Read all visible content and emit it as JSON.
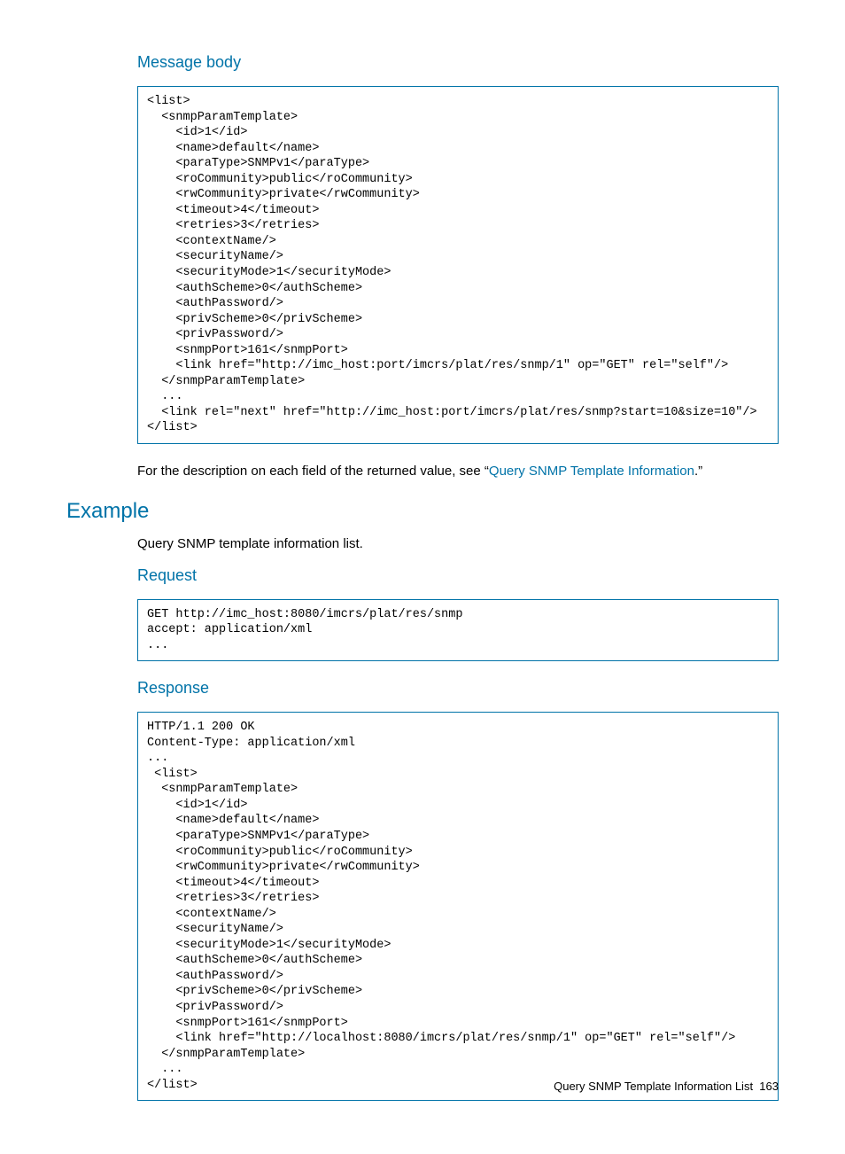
{
  "section_message_body": {
    "heading": "Message body",
    "code": "<list>\n  <snmpParamTemplate>\n    <id>1</id>\n    <name>default</name>\n    <paraType>SNMPv1</paraType>\n    <roCommunity>public</roCommunity>\n    <rwCommunity>private</rwCommunity>\n    <timeout>4</timeout>\n    <retries>3</retries>\n    <contextName/>\n    <securityName/>\n    <securityMode>1</securityMode>\n    <authScheme>0</authScheme>\n    <authPassword/>\n    <privScheme>0</privScheme>\n    <privPassword/>\n    <snmpPort>161</snmpPort>\n    <link href=\"http://imc_host:port/imcrs/plat/res/snmp/1\" op=\"GET\" rel=\"self\"/>\n  </snmpParamTemplate>\n  ...\n  <link rel=\"next\" href=\"http://imc_host:port/imcrs/plat/res/snmp?start=10&size=10\"/>\n</list>"
  },
  "description_para": {
    "prefix": "For the description on each field of the returned value, see “",
    "link_text": "Query SNMP Template Information",
    "suffix": ".”"
  },
  "example": {
    "heading": "Example",
    "intro": "Query SNMP template information list."
  },
  "request": {
    "heading": "Request",
    "code": "GET http://imc_host:8080/imcrs/plat/res/snmp\naccept: application/xml\n..."
  },
  "response": {
    "heading": "Response",
    "code": "HTTP/1.1 200 OK\nContent-Type: application/xml\n...\n <list>\n  <snmpParamTemplate>\n    <id>1</id>\n    <name>default</name>\n    <paraType>SNMPv1</paraType>\n    <roCommunity>public</roCommunity>\n    <rwCommunity>private</rwCommunity>\n    <timeout>4</timeout>\n    <retries>3</retries>\n    <contextName/>\n    <securityName/>\n    <securityMode>1</securityMode>\n    <authScheme>0</authScheme>\n    <authPassword/>\n    <privScheme>0</privScheme>\n    <privPassword/>\n    <snmpPort>161</snmpPort>\n    <link href=\"http://localhost:8080/imcrs/plat/res/snmp/1\" op=\"GET\" rel=\"self\"/>\n  </snmpParamTemplate>\n  ...\n</list>"
  },
  "footer": {
    "title": "Query SNMP Template Information List",
    "page": "163"
  }
}
